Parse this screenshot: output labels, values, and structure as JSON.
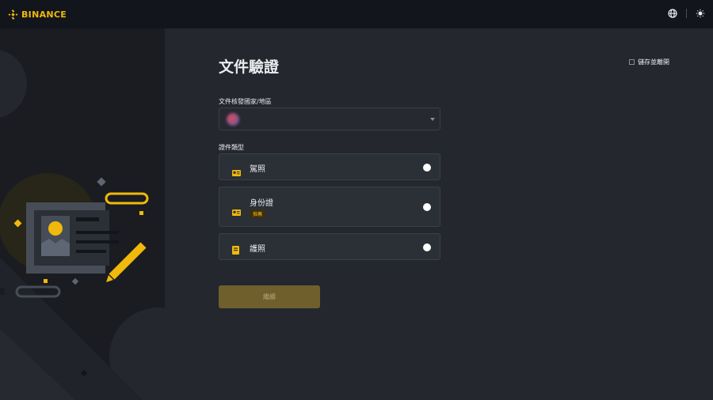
{
  "header": {
    "brand": "BINANCE",
    "brand_color": "#f0b90b",
    "icons": [
      "globe-icon",
      "theme-icon"
    ]
  },
  "page": {
    "title": "文件驗證",
    "save_exit_label": "儲存並離開"
  },
  "country": {
    "label": "文件核發國家/地區",
    "selected_value": ""
  },
  "doc_type": {
    "label": "證件類型",
    "options": [
      {
        "label": "駕照",
        "icon": "license-icon",
        "badge": ""
      },
      {
        "label": "身份證",
        "icon": "id-card-icon",
        "badge": "推薦"
      },
      {
        "label": "護照",
        "icon": "passport-icon",
        "badge": ""
      }
    ]
  },
  "actions": {
    "continue_label": "繼續"
  }
}
